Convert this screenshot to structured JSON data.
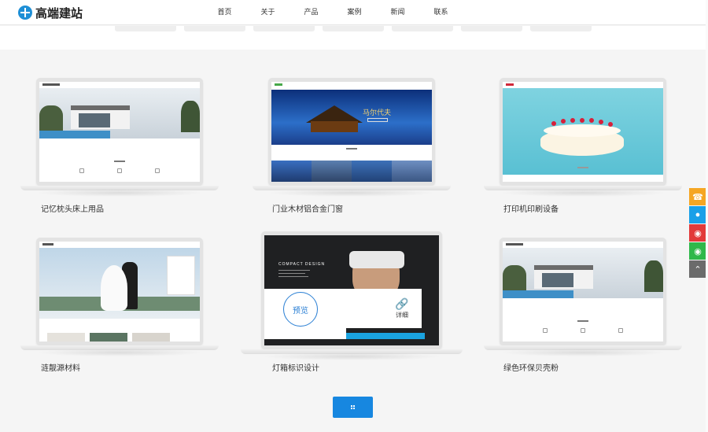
{
  "header": {
    "logo_text": "高端建站",
    "nav": [
      "首页",
      "关于",
      "产品",
      "案例",
      "新闻",
      "联系"
    ]
  },
  "resort": {
    "text": "马尔代夫"
  },
  "cards": [
    {
      "label": "记忆枕头床上用品"
    },
    {
      "label": "门业木材铝合金门窗"
    },
    {
      "label": "打印机印刷设备"
    },
    {
      "label": "涟靓源材料"
    },
    {
      "label": "灯箱标识设计"
    },
    {
      "label": "绿色环保贝壳粉"
    }
  ],
  "overlay": {
    "preview_label": "预览",
    "detail_label": "详细",
    "vr_title": "COMPACT DESIGN"
  },
  "colors": {
    "accent": "#1787e0",
    "side_phone": "#f5a623",
    "side_qq": "#1aa0e8",
    "side_weibo": "#e23a3a",
    "side_wechat": "#2fb84a",
    "side_top": "#6b6b6b"
  },
  "side_icons": [
    "phone-icon",
    "qq-icon",
    "weibo-icon",
    "wechat-icon",
    "back-to-top-icon"
  ]
}
